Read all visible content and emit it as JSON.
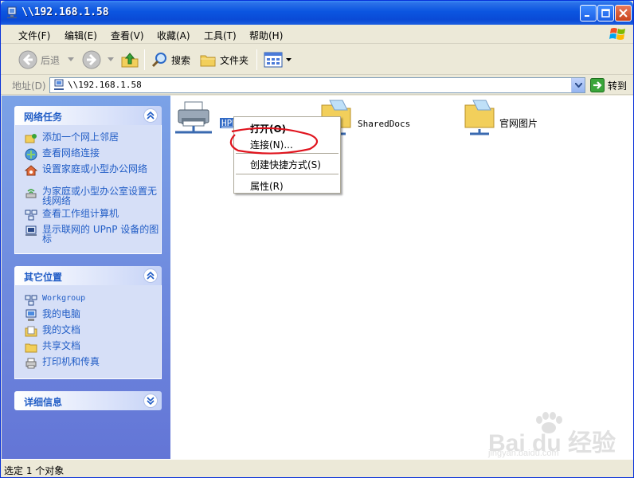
{
  "window": {
    "title": "\\\\192.168.1.58"
  },
  "menubar": {
    "items": [
      "文件(F)",
      "编辑(E)",
      "查看(V)",
      "收藏(A)",
      "工具(T)",
      "帮助(H)"
    ]
  },
  "toolbar": {
    "back_label": "后退",
    "search_label": "搜索",
    "folders_label": "文件夹"
  },
  "address": {
    "label": "地址(D)",
    "value": "\\\\192.168.1.58",
    "go_label": "转到"
  },
  "network_tasks": {
    "title": "网络任务",
    "items": [
      {
        "label": "添加一个网上邻居",
        "icon": "add-network-place-icon"
      },
      {
        "label": "查看网络连接",
        "icon": "network-connections-icon"
      },
      {
        "label": "设置家庭或小型办公网络",
        "icon": "home-network-icon"
      },
      {
        "label": "为家庭或小型办公室设置无线网络",
        "icon": "wireless-network-icon"
      },
      {
        "label": "查看工作组计算机",
        "icon": "workgroup-computers-icon"
      },
      {
        "label": "显示联网的 UPnP 设备的图标",
        "icon": "upnp-device-icon"
      }
    ]
  },
  "other_places": {
    "title": "其它位置",
    "items": [
      {
        "label": "Workgroup",
        "icon": "workgroup-icon"
      },
      {
        "label": "我的电脑",
        "icon": "my-computer-icon"
      },
      {
        "label": "我的文档",
        "icon": "my-documents-icon"
      },
      {
        "label": "共享文档",
        "icon": "shared-documents-icon"
      },
      {
        "label": "打印机和传真",
        "icon": "printers-faxes-icon"
      }
    ]
  },
  "details": {
    "title": "详细信息"
  },
  "content": {
    "items": [
      {
        "label": "HPLa",
        "icon": "shared-printer-icon",
        "selected": true
      },
      {
        "label": "SharedDocs",
        "icon": "shared-folder-icon"
      },
      {
        "label": "官网图片",
        "icon": "shared-folder-icon"
      }
    ]
  },
  "context_menu": {
    "items": [
      "打开(O)",
      "连接(N)...",
      "创建快捷方式(S)",
      "属性(R)"
    ]
  },
  "status": {
    "text": "选定 1 个对象"
  },
  "watermark": {
    "brand": "Bai du 经验",
    "url": "jingyan.baidu.com"
  },
  "colors": {
    "title_bar": "#0a4ad6",
    "task_link": "#215dc6",
    "left_pane": "#6375d6",
    "annotation": "#e0141e"
  }
}
